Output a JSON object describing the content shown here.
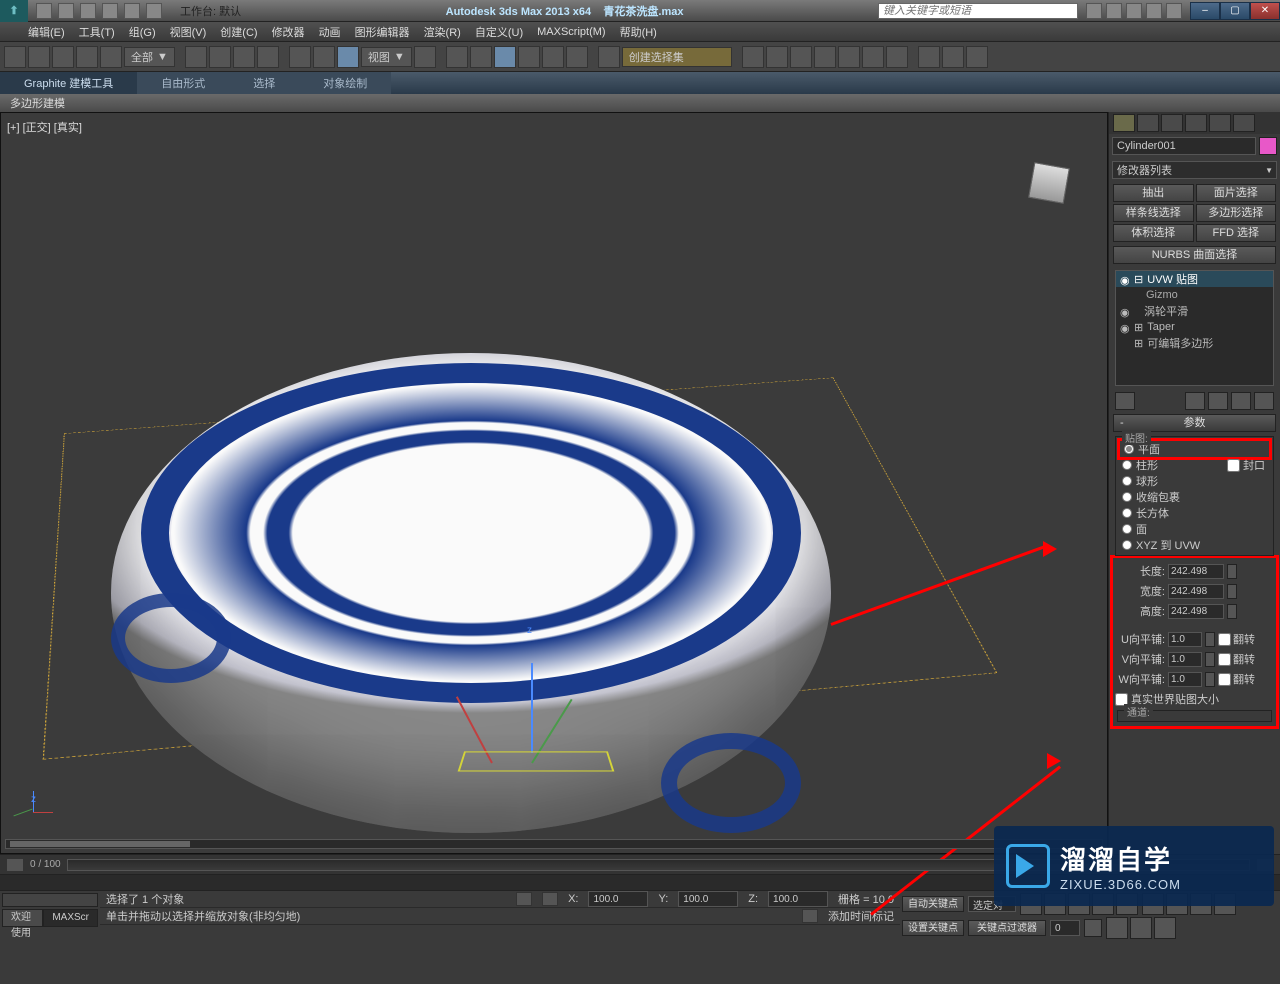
{
  "titlebar": {
    "workspace_label": "工作台: 默认",
    "app_title": "Autodesk 3ds Max  2013 x64",
    "filename": "青花茶洗盘.max",
    "search_placeholder": "键入关键字或短语"
  },
  "menu": [
    "编辑(E)",
    "工具(T)",
    "组(G)",
    "视图(V)",
    "创建(C)",
    "修改器",
    "动画",
    "图形编辑器",
    "渲染(R)",
    "自定义(U)",
    "MAXScript(M)",
    "帮助(H)"
  ],
  "toolbar": {
    "scope_combo": "全部",
    "view_combo": "视图"
  },
  "ribbon": {
    "tabs": [
      "Graphite 建模工具",
      "自由形式",
      "选择",
      "对象绘制"
    ],
    "sub": "多边形建模"
  },
  "viewport": {
    "label": "[+] [正交] [真实]",
    "gizmo_axis": "z",
    "frame_info": "0 / 100"
  },
  "right_panel": {
    "object_name": "Cylinder001",
    "modifier_list_label": "修改器列表",
    "buttons": [
      "抽出",
      "面片选择",
      "样条线选择",
      "多边形选择",
      "体积选择",
      "FFD 选择"
    ],
    "nurbs_label": "NURBS 曲面选择",
    "stack": [
      {
        "label": "UVW 贴图",
        "sel": true,
        "expand": "⊟",
        "eye": "◉"
      },
      {
        "label": "Gizmo",
        "child": true
      },
      {
        "label": "涡轮平滑",
        "eye": "◉"
      },
      {
        "label": "Taper",
        "eye": "◉",
        "expand": "⊞"
      },
      {
        "label": "可编辑多边形",
        "expand": "⊞"
      }
    ],
    "rollout_title": "参数",
    "map_group_label": "贴图:",
    "map_types": [
      "平面",
      "柱形",
      "球形",
      "收缩包裹",
      "长方体",
      "面",
      "XYZ 到 UVW"
    ],
    "cap_label": "封口",
    "dims": {
      "length_label": "长度:",
      "length_val": "242.498",
      "width_label": "宽度:",
      "width_val": "242.498",
      "height_label": "高度:",
      "height_val": "242.498"
    },
    "tiles": {
      "u_label": "U向平铺:",
      "u_val": "1.0",
      "v_label": "V向平铺:",
      "v_val": "1.0",
      "w_label": "W向平铺:",
      "w_val": "1.0",
      "flip_label": "翻转"
    },
    "real_world_label": "真实世界贴图大小",
    "channel_label": "通道:"
  },
  "status": {
    "selection_text": "选择了 1 个对象",
    "prompt_text": "单击并拖动以选择并缩放对象(非均匀地)",
    "x_label": "X:",
    "x_val": "100.0",
    "y_label": "Y:",
    "y_val": "100.0",
    "z_label": "Z:",
    "z_val": "100.0",
    "grid_label": "栅格 = 10.0",
    "add_marker": "添加时间标记",
    "auto_key": "自动关键点",
    "sel_filter": "选定对",
    "set_key": "设置关键点",
    "key_filter": "关键点过滤器",
    "welcome": "欢迎使用",
    "script": "MAXScr"
  },
  "watermark": {
    "title": "溜溜自学",
    "url": "ZIXUE.3D66.COM"
  }
}
